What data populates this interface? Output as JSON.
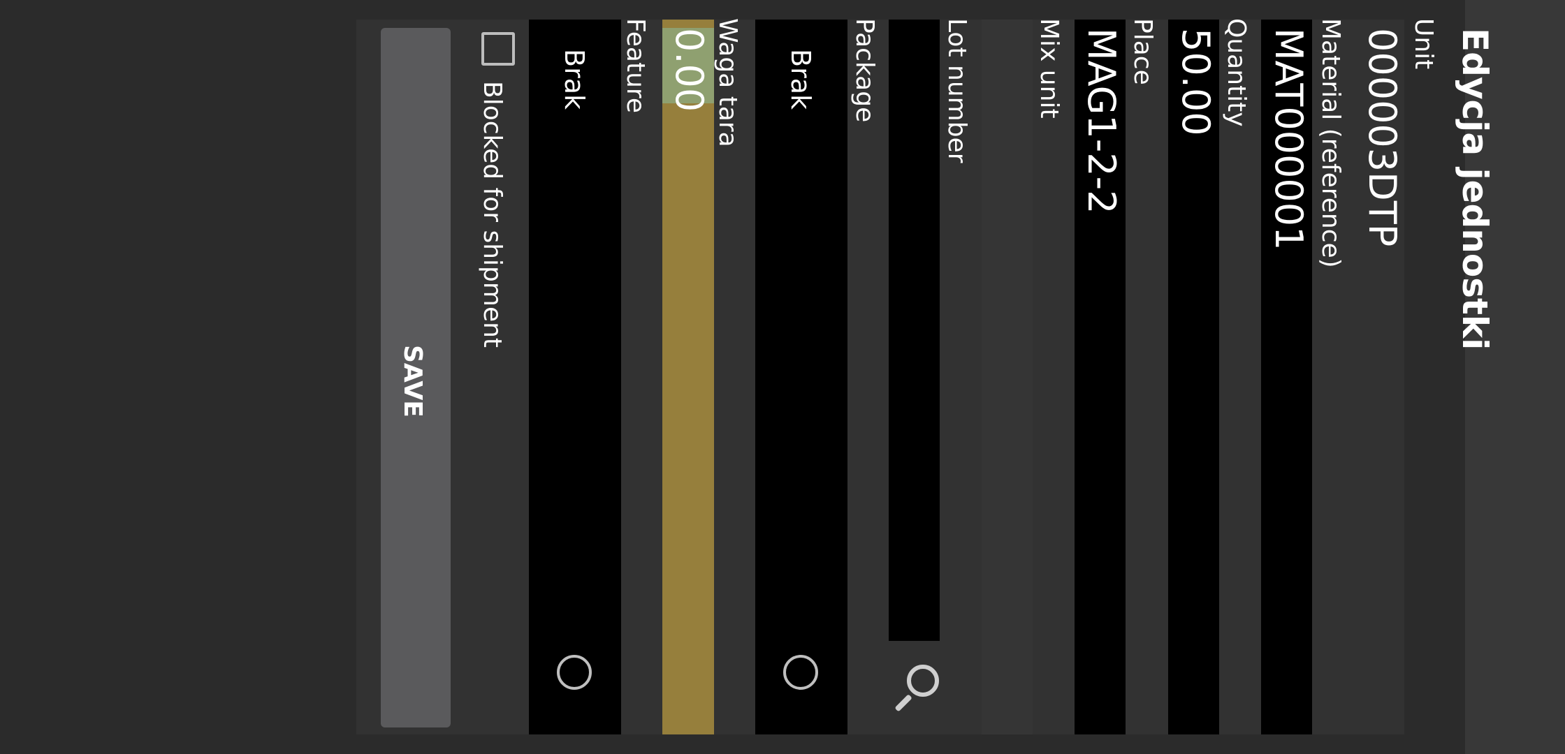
{
  "header": {
    "title": "Edycja jednostki"
  },
  "form": {
    "unit": {
      "label": "Unit",
      "value": "000003DTP"
    },
    "material": {
      "label": "Material (reference)",
      "value": "MAT000001"
    },
    "quantity": {
      "label": "Quantity",
      "value": "50.00"
    },
    "place": {
      "label": "Place",
      "value": "MAG1-2-2"
    },
    "mix_unit": {
      "label": "Mix unit"
    },
    "lot_number": {
      "label": "Lot number",
      "value": ""
    },
    "package": {
      "label": "Package",
      "value": "Brak"
    },
    "waga_tara": {
      "label": "Waga tara",
      "value": "0.00"
    },
    "feature": {
      "label": "Feature",
      "value": "Brak"
    },
    "blocked": {
      "label": "Blocked for shipment",
      "checked": false
    }
  },
  "actions": {
    "save_label": "SAVE"
  },
  "colors": {
    "background": "#2b2b2b",
    "field": "#000000",
    "tara_highlight": "#967f3c",
    "tara_selection": "#8fa070",
    "button": "#5a5a5c"
  },
  "icons": {
    "lot_search": "search-icon",
    "radio": "radio-icon",
    "checkbox": "checkbox-icon"
  }
}
